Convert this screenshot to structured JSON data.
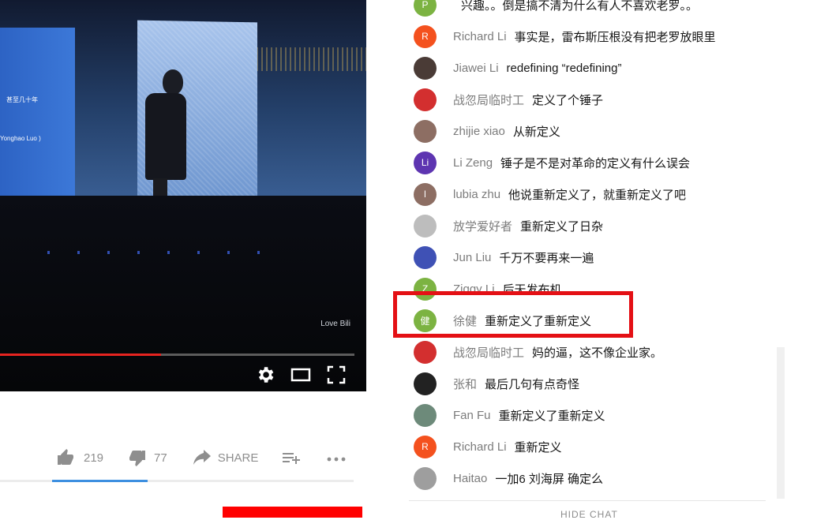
{
  "video": {
    "screen_text_1": "甚至几十年",
    "screen_text_2": "Yonghao Luo )",
    "watermark": "Love Bili",
    "progress_fraction": 0.455,
    "controls": {
      "settings_icon": "gear-icon",
      "theater_icon": "theater-mode-icon",
      "fullscreen_icon": "fullscreen-icon"
    }
  },
  "actions": {
    "like_count": "219",
    "dislike_count": "77",
    "share_label": "SHARE",
    "like_ratio": 0.74
  },
  "chat": {
    "messages": [
      {
        "author": "",
        "text": "兴趣。。倒是搞不清为什么有人不喜欢老罗。。",
        "initial": "P",
        "color": "#7cb342"
      },
      {
        "author": "Richard Li",
        "text": "事实是，雷布斯压根没有把老罗放眼里",
        "initial": "R",
        "color": "#f4511e"
      },
      {
        "author": "Jiawei Li",
        "text": "redefining “redefining”",
        "initial": "",
        "color": "#4a3b36"
      },
      {
        "author": "战忽局临时工",
        "text": "定义了个锤子",
        "initial": "",
        "color": "#d32f2f"
      },
      {
        "author": "zhijie xiao",
        "text": "从新定义",
        "initial": "",
        "color": "#8d6e63"
      },
      {
        "author": "Li Zeng",
        "text": "锤子是不是对革命的定义有什么误会",
        "initial": "Li",
        "color": "#5e35b1"
      },
      {
        "author": "lubia zhu",
        "text": "他说重新定义了，就重新定义了吧",
        "initial": "l",
        "color": "#8d6e63"
      },
      {
        "author": "放学爱好者",
        "text": "重新定义了日杂",
        "initial": "",
        "color": "#bdbdbd"
      },
      {
        "author": "Jun Liu",
        "text": "千万不要再来一遍",
        "initial": "",
        "color": "#3f51b5"
      },
      {
        "author": "Ziggy Li",
        "text": "后天发布机",
        "initial": "Z",
        "color": "#7cb342"
      },
      {
        "author": "徐健",
        "text": "重新定义了重新定义",
        "initial": "健",
        "color": "#7cb342"
      },
      {
        "author": "战忽局临时工",
        "text": "妈的逼，这不像企业家。",
        "initial": "",
        "color": "#d32f2f"
      },
      {
        "author": "张和",
        "text": "最后几句有点奇怪",
        "initial": "",
        "color": "#222222"
      },
      {
        "author": "Fan Fu",
        "text": "重新定义了重新定义",
        "initial": "",
        "color": "#6d8a7a"
      },
      {
        "author": "Richard Li",
        "text": "重新定义",
        "initial": "R",
        "color": "#f4511e"
      },
      {
        "author": "Haitao",
        "text": "一加6 刘海屏 确定么",
        "initial": "",
        "color": "#9e9e9e"
      }
    ],
    "hide_chat_label": "HIDE CHAT"
  }
}
